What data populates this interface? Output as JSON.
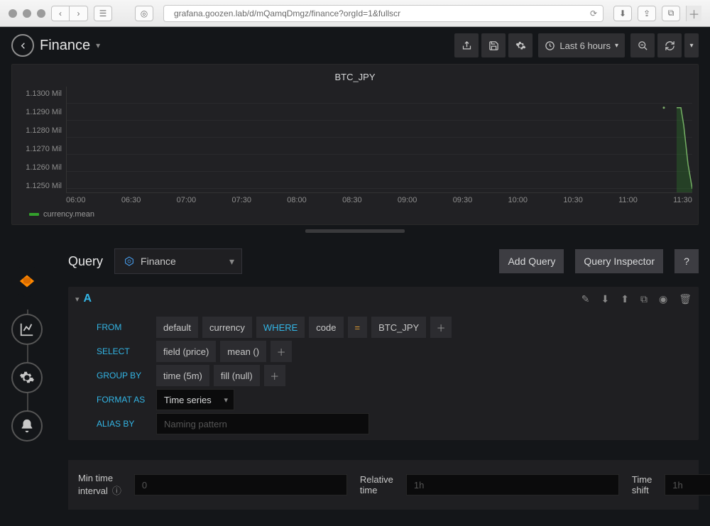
{
  "browser": {
    "url": "grafana.goozen.lab/d/mQamqDmgz/finance?orgId=1&fullscr"
  },
  "header": {
    "title": "Finance",
    "timerange": "Last 6 hours"
  },
  "chart_data": {
    "type": "line",
    "title": "BTC_JPY",
    "ylabel": "",
    "xlabel": "",
    "y_ticks": [
      "1.1300 Mil",
      "1.1290 Mil",
      "1.1280 Mil",
      "1.1270 Mil",
      "1.1260 Mil",
      "1.1250 Mil"
    ],
    "x_ticks": [
      "06:00",
      "06:30",
      "07:00",
      "07:30",
      "08:00",
      "08:30",
      "09:00",
      "09:30",
      "10:00",
      "10:30",
      "11:00",
      "11:30"
    ],
    "series": [
      {
        "name": "currency.mean",
        "color": "#33a02c",
        "x": [
          "11:20",
          "11:24",
          "11:26",
          "11:28",
          "11:30"
        ],
        "values": [
          1129000,
          1129000,
          1128000,
          1126000,
          1125000
        ]
      }
    ],
    "ylim": [
      1125000,
      1130000
    ]
  },
  "query_section": {
    "heading": "Query",
    "datasource": "Finance",
    "add_query": "Add Query",
    "inspector": "Query Inspector",
    "help": "?"
  },
  "query": {
    "name": "A",
    "from_kw": "FROM",
    "from_policy": "default",
    "from_measurement": "currency",
    "where_kw": "WHERE",
    "where_field": "code",
    "where_op": "=",
    "where_value": "BTC_JPY",
    "select_kw": "SELECT",
    "select_field": "field (price)",
    "select_agg": "mean ()",
    "groupby_kw": "GROUP BY",
    "groupby_time": "time (5m)",
    "groupby_fill": "fill (null)",
    "formatas_kw": "FORMAT AS",
    "formatas_value": "Time series",
    "aliasby_kw": "ALIAS BY",
    "aliasby_placeholder": "Naming pattern"
  },
  "options": {
    "min_interval_label": "Min time interval",
    "min_interval_placeholder": "0",
    "relative_time_label": "Relative time",
    "relative_time_placeholder": "1h",
    "time_shift_label": "Time shift",
    "time_shift_placeholder": "1h"
  }
}
